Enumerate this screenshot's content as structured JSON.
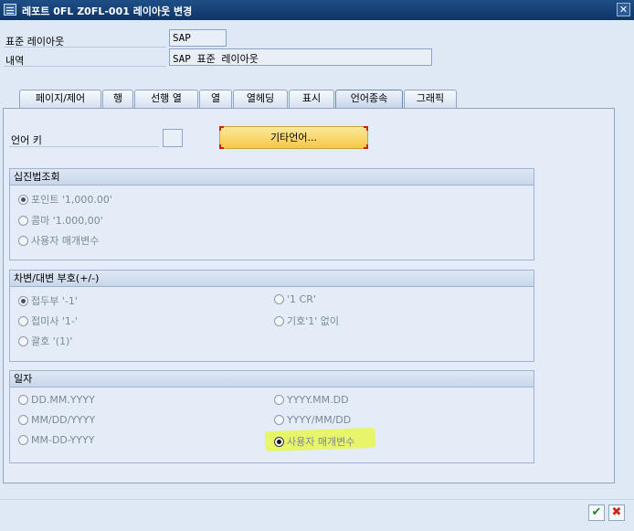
{
  "window": {
    "title": "레포트 0FL Z0FL-001 레이아웃 변경",
    "close_label": "✕"
  },
  "header": {
    "std_layout_label": "표준 레이아웃",
    "std_layout_value": "SAP",
    "desc_label": "내역",
    "desc_value": "SAP 표준 레이아웃"
  },
  "tabs": [
    {
      "label": "페이지/제어"
    },
    {
      "label": "행"
    },
    {
      "label": "선행 열"
    },
    {
      "label": "열"
    },
    {
      "label": "열헤딩"
    },
    {
      "label": "표시"
    },
    {
      "label": "언어종속"
    },
    {
      "label": "그래픽"
    }
  ],
  "active_tab": "언어종속",
  "language": {
    "label": "언어 키",
    "other_button": "기타언어..."
  },
  "decimal_group": {
    "title": "십진법조회",
    "options": [
      {
        "label": "포인트 '1,000.00'",
        "selected": true
      },
      {
        "label": "콤마 '1.000,00'",
        "selected": false
      },
      {
        "label": "사용자 매개변수",
        "selected": false
      }
    ]
  },
  "sign_group": {
    "title": "차변/대변 부호(+/-)",
    "left": [
      {
        "label": "접두부 '-1'",
        "selected": true
      },
      {
        "label": "접미사 '1-'",
        "selected": false
      },
      {
        "label": "괄호 '(1)'",
        "selected": false
      }
    ],
    "right": [
      {
        "label": "'1 CR'",
        "selected": false
      },
      {
        "label": "기호'1' 없이",
        "selected": false
      }
    ]
  },
  "date_group": {
    "title": "일자",
    "left": [
      {
        "label": "DD.MM.YYYY",
        "selected": false
      },
      {
        "label": "MM/DD/YYYY",
        "selected": false
      },
      {
        "label": "MM-DD-YYYY",
        "selected": false
      }
    ],
    "right": [
      {
        "label": "YYYY.MM.DD",
        "selected": false
      },
      {
        "label": "YYYY/MM/DD",
        "selected": false
      },
      {
        "label": "사용자 매개변수",
        "selected": true
      }
    ]
  },
  "footer": {
    "ok_icon": "check-icon",
    "cancel_icon": "cancel-icon"
  }
}
